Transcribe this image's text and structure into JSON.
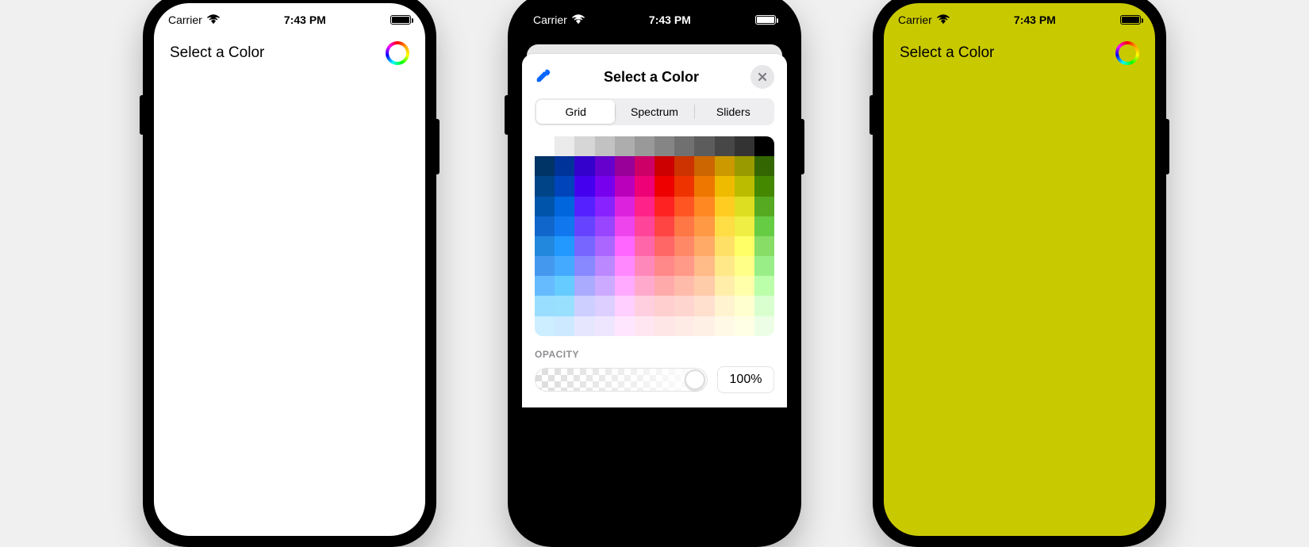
{
  "status": {
    "carrier": "Carrier",
    "time": "7:43 PM"
  },
  "label": "Select a Color",
  "picker": {
    "title": "Select a Color",
    "segments": {
      "grid": "Grid",
      "spectrum": "Spectrum",
      "sliders": "Sliders"
    },
    "opacity": {
      "label": "OPACITY",
      "value": "100%"
    },
    "grid_rows": [
      [
        "#ffffff",
        "#ebebeb",
        "#d6d6d6",
        "#c2c2c2",
        "#adadad",
        "#999999",
        "#858585",
        "#707070",
        "#5c5c5c",
        "#474747",
        "#333333",
        "#000000"
      ],
      [
        "#003366",
        "#003399",
        "#3300cc",
        "#6600cc",
        "#990099",
        "#cc0066",
        "#cc0000",
        "#cc3300",
        "#cc6600",
        "#cc9900",
        "#999900",
        "#336600"
      ],
      [
        "#004488",
        "#0044bb",
        "#4400ee",
        "#7700ee",
        "#bb00bb",
        "#ee0077",
        "#ee0000",
        "#ee3300",
        "#ee7700",
        "#eebb00",
        "#bbbb00",
        "#448800"
      ],
      [
        "#0055aa",
        "#0066dd",
        "#5522ff",
        "#8822ff",
        "#dd22dd",
        "#ff2288",
        "#ff2222",
        "#ff5522",
        "#ff8822",
        "#ffcc22",
        "#dddd22",
        "#55aa22"
      ],
      [
        "#1166cc",
        "#1177ee",
        "#6644ff",
        "#9944ff",
        "#ee44ee",
        "#ff4499",
        "#ff4444",
        "#ff7744",
        "#ff9944",
        "#ffdd44",
        "#eeee44",
        "#66cc44"
      ],
      [
        "#2288dd",
        "#2299ff",
        "#7766ff",
        "#aa66ff",
        "#ff66ff",
        "#ff66aa",
        "#ff6666",
        "#ff8866",
        "#ffaa66",
        "#ffe066",
        "#ffff66",
        "#88dd66"
      ],
      [
        "#4499ee",
        "#44aaff",
        "#8888ff",
        "#bb88ff",
        "#ff88ff",
        "#ff88bb",
        "#ff8888",
        "#ff9988",
        "#ffbb88",
        "#ffe888",
        "#ffff88",
        "#99ee88"
      ],
      [
        "#66bbff",
        "#66ccff",
        "#aaaaff",
        "#ccaaff",
        "#ffaaff",
        "#ffaacc",
        "#ffaaaa",
        "#ffbbaa",
        "#ffccaa",
        "#ffeeaa",
        "#ffffaa",
        "#bbffaa"
      ],
      [
        "#99ddff",
        "#99e0ff",
        "#cccfff",
        "#ddcfff",
        "#ffcfff",
        "#ffcfe0",
        "#ffcfcf",
        "#ffd6cf",
        "#ffe0cf",
        "#fff4cf",
        "#ffffcf",
        "#d9ffcf"
      ],
      [
        "#cceeff",
        "#cce9ff",
        "#e6e6ff",
        "#eee6ff",
        "#ffe6ff",
        "#ffe6f0",
        "#ffe6e6",
        "#ffebe6",
        "#fff0e6",
        "#fff9e6",
        "#ffffe6",
        "#ecffe6"
      ]
    ]
  }
}
